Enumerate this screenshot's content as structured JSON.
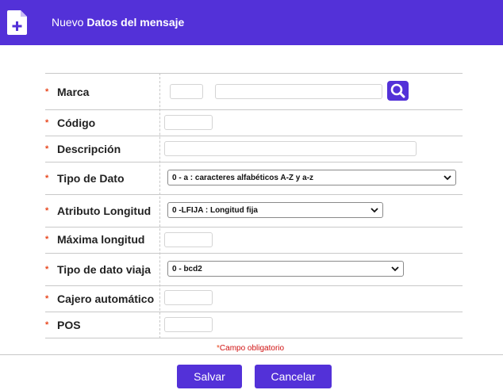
{
  "header": {
    "title_prefix": "Nuevo",
    "title_main": "Datos del mensaje",
    "icon": "add-document-icon"
  },
  "form": {
    "required_mark": "*",
    "fields": [
      {
        "label": "Marca",
        "value_code": "",
        "value_name": ""
      },
      {
        "label": "Código",
        "value": ""
      },
      {
        "label": "Descripción",
        "value": ""
      },
      {
        "label": "Tipo de Dato",
        "selected": "0 - a : caracteres alfabéticos A-Z y a-z"
      },
      {
        "label": "Atributo Longitud",
        "selected": "0 -LFIJA : Longitud fija"
      },
      {
        "label": "Máxima longitud",
        "value": ""
      },
      {
        "label": "Tipo de dato viaja",
        "selected": "0 - bcd2"
      },
      {
        "label": "Cajero automático",
        "value": ""
      },
      {
        "label": "POS",
        "value": ""
      }
    ],
    "search_icon": "search-icon",
    "required_note": "Campo obligatorio"
  },
  "buttons": {
    "save": "Salvar",
    "cancel": "Cancelar"
  },
  "colors": {
    "brand": "#5331d8",
    "required": "#e8471e",
    "note": "#d01010"
  }
}
